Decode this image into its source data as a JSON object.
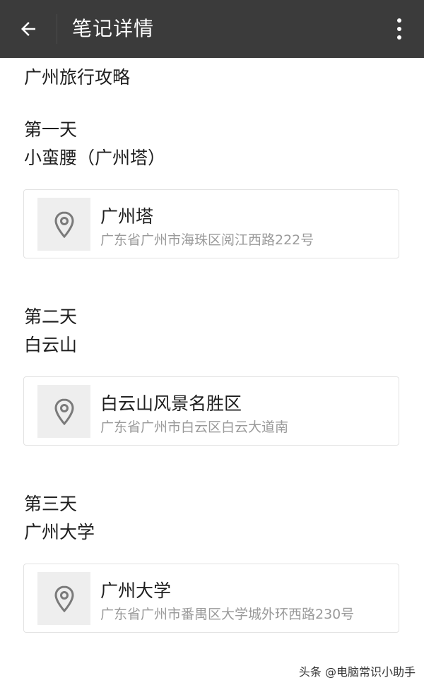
{
  "header": {
    "title": "笔记详情",
    "back_icon": "arrow-left-icon",
    "more_icon": "more-vertical-icon",
    "bg_color": "#3b3b3b"
  },
  "note": {
    "title": "广州旅行攻略",
    "days": [
      {
        "label": "第一天",
        "place": "小蛮腰（广州塔）",
        "location": {
          "name": "广州塔",
          "address": "广东省广州市海珠区阅江西路222号",
          "icon": "map-pin-icon"
        }
      },
      {
        "label": "第二天",
        "place": "白云山",
        "location": {
          "name": "白云山风景名胜区",
          "address": "广东省广州市白云区白云大道南",
          "icon": "map-pin-icon"
        }
      },
      {
        "label": "第三天",
        "place": "广州大学",
        "location": {
          "name": "广州大学",
          "address": "广东省广州市番禺区大学城外环西路230号",
          "icon": "map-pin-icon"
        }
      }
    ]
  },
  "watermark": "头条 @电脑常识小助手"
}
